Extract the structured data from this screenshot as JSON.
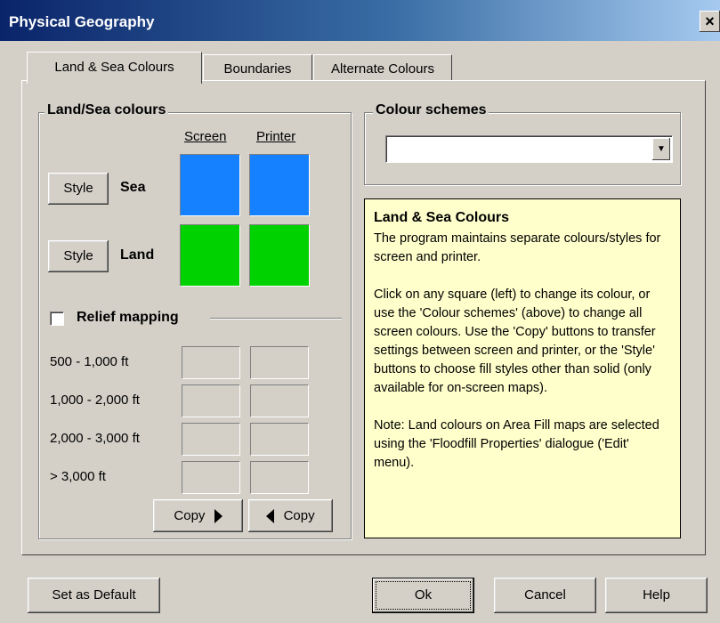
{
  "window": {
    "title": "Physical Geography",
    "close_glyph": "×"
  },
  "tabs": [
    {
      "label": "Land & Sea Colours",
      "active": true
    },
    {
      "label": "Boundaries",
      "active": false
    },
    {
      "label": "Alternate Colours",
      "active": false
    }
  ],
  "land_sea": {
    "legend": "Land/Sea colours",
    "col_screen": "Screen",
    "col_printer": "Printer",
    "rows": [
      {
        "style_label": "Style",
        "name": "Sea",
        "screen_color": "#1681ff",
        "printer_color": "#1681ff"
      },
      {
        "style_label": "Style",
        "name": "Land",
        "screen_color": "#00d200",
        "printer_color": "#00d200"
      }
    ]
  },
  "relief": {
    "label": "Relief mapping",
    "checked": false,
    "bands": [
      "500 - 1,000 ft",
      "1,000 - 2,000 ft",
      "2,000 - 3,000 ft",
      "> 3,000 ft"
    ],
    "copy_right_label": "Copy",
    "copy_left_label": "Copy"
  },
  "colour_schemes": {
    "legend": "Colour schemes",
    "selected": ""
  },
  "help": {
    "title": "Land & Sea Colours",
    "p1": "The program maintains separate colours/styles for screen and printer.",
    "p2": "Click on any square (left) to change its colour, or use the 'Colour schemes' (above) to change all screen colours.  Use the 'Copy' buttons to transfer settings between screen and printer, or the 'Style' buttons to choose fill styles other than solid (only available for on-screen maps).",
    "p3": "Note: Land colours on Area Fill maps are selected using the 'Floodfill Properties' dialogue ('Edit' menu)."
  },
  "footer": {
    "set_default": "Set as Default",
    "ok": "Ok",
    "cancel": "Cancel",
    "help": "Help"
  }
}
